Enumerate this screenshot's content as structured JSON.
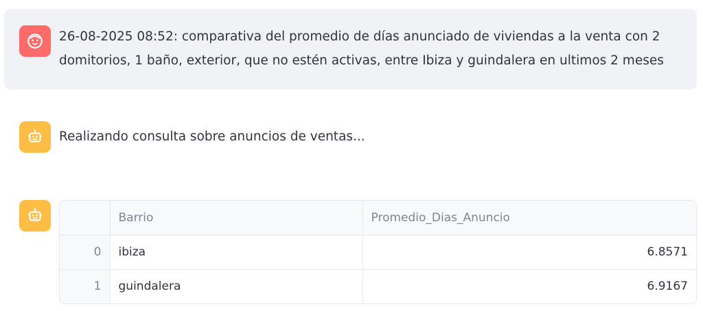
{
  "user_message": {
    "line1": "26-08-2025 08:52: comparativa del promedio de días anunciado de viviendas a la venta con 2",
    "line2": "domitorios, 1 baño, exterior, que no estén activas, entre Ibiza y guindalera en ultimos 2 meses",
    "avatar_icon": "user-face-icon",
    "avatar_color": "#ff6b6b"
  },
  "assistant_status": {
    "text": "Realizando consulta sobre anuncios de ventas...",
    "avatar_icon": "robot-icon",
    "avatar_color": "#ffbd45"
  },
  "result_table": {
    "columns": [
      "",
      "Barrio",
      "Promedio_Dias_Anuncio"
    ],
    "rows": [
      {
        "index": "0",
        "barrio": "ibiza",
        "promedio": "6.8571"
      },
      {
        "index": "1",
        "barrio": "guindalera",
        "promedio": "6.9167"
      }
    ]
  }
}
